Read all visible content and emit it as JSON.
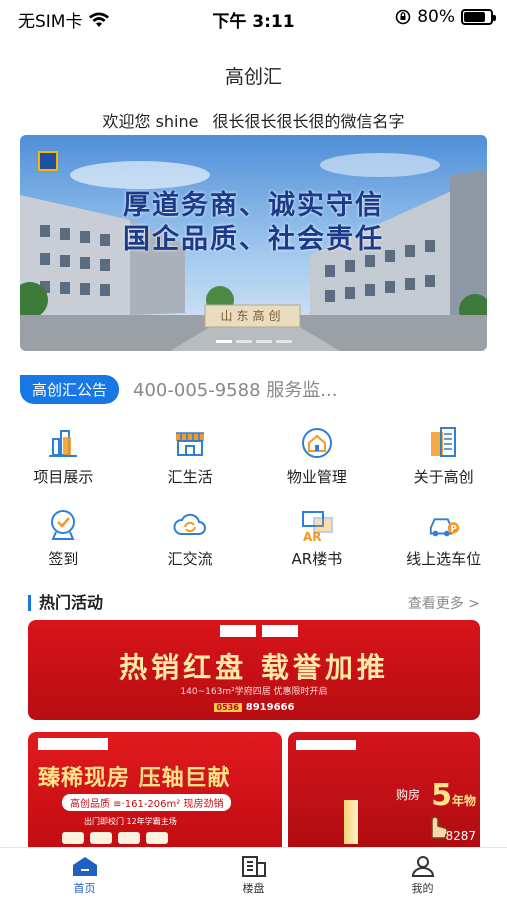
{
  "status_bar": {
    "carrier": "无SIM卡",
    "time": "下午 3:11",
    "battery": "80%",
    "battery_level": 0.8
  },
  "app": {
    "title": "高创汇",
    "welcome_prefix": "欢迎您 shine",
    "welcome_name": "很长很长很长很的微信名字"
  },
  "banner": {
    "slogan_line1": "厚道务商、诚实守信",
    "slogan_line2": "国企品质、社会责任",
    "gate_sign": "山东高创",
    "page_count": 4,
    "active_page": 0
  },
  "notice": {
    "badge": "高创汇公告",
    "text": "400-005-9588 服务监..."
  },
  "menu": [
    {
      "label": "项目展示",
      "icon": "building-chart-icon"
    },
    {
      "label": "汇生活",
      "icon": "storefront-icon"
    },
    {
      "label": "物业管理",
      "icon": "home-circle-icon"
    },
    {
      "label": "关于高创",
      "icon": "city-map-icon"
    },
    {
      "label": "签到",
      "icon": "checkin-badge-icon"
    },
    {
      "label": "汇交流",
      "icon": "sync-cloud-icon"
    },
    {
      "label": "AR楼书",
      "icon": "ar-book-icon"
    },
    {
      "label": "线上选车位",
      "icon": "car-parking-icon"
    }
  ],
  "hot": {
    "title": "热门活动",
    "more": "查看更多 >",
    "promo_main": {
      "title": "热销红盘  载誉加推",
      "sub": "140~163m²学府四居 优惠限时开启",
      "phone_prefix": "0536",
      "phone": "8919666"
    },
    "promo_left": {
      "title": "臻稀现房 压轴巨献",
      "pill": "高创品质 ≡·161-206m² 现房劲销",
      "line": "出门即校门 12年学霸主场"
    },
    "promo_right": {
      "buy": "购房",
      "big_num": "5",
      "big_text": "年物",
      "num": "8287"
    }
  },
  "tabbar": [
    {
      "label": "首页",
      "icon": "home-icon",
      "active": true
    },
    {
      "label": "楼盘",
      "icon": "building-list-icon",
      "active": false
    },
    {
      "label": "我的",
      "icon": "user-icon",
      "active": false
    }
  ],
  "colors": {
    "accent": "#1677e5",
    "icon_blue": "#2f7fd6",
    "icon_orange": "#f39a25",
    "promo_red": "#d8141a",
    "tab_active": "#1f5fbf"
  }
}
